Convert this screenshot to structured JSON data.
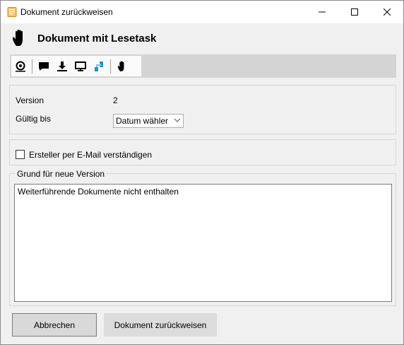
{
  "window": {
    "title": "Dokument zurückweisen"
  },
  "header": {
    "title": "Dokument mit Lesetask"
  },
  "toolbar": {
    "items": [
      {
        "icon": "lifebuoy-icon"
      },
      {
        "icon": "comment-icon"
      },
      {
        "icon": "download-icon"
      },
      {
        "icon": "monitor-icon"
      },
      {
        "icon": "transfer-icon"
      },
      {
        "icon": "hand-stop-icon"
      }
    ]
  },
  "form": {
    "version_label": "Version",
    "version_value": "2",
    "valid_until_label": "Gültig bis",
    "date_picker_value": "Datum wähler",
    "notify_creator_label": "Ersteller per E-Mail verständigen",
    "notify_creator_checked": false,
    "reason_legend": "Grund für neue Version",
    "reason_text": "Weiterführende Dokumente nicht enthalten"
  },
  "buttons": {
    "cancel": "Abbrechen",
    "reject": "Dokument zurückweisen"
  },
  "colors": {
    "accent_blue": "#1e90d6",
    "toolbar_bg": "#d4d4d4",
    "window_bg": "#f0f0f0"
  }
}
